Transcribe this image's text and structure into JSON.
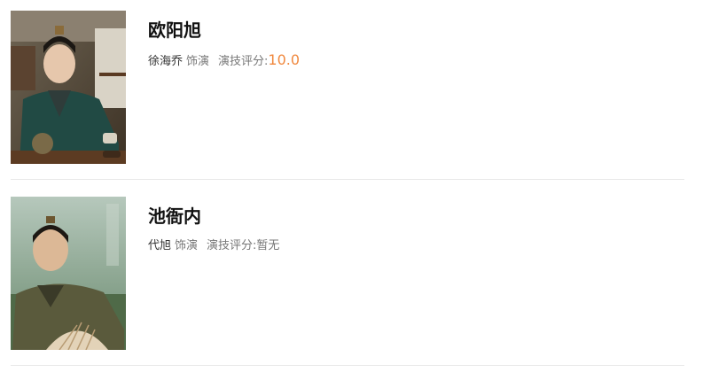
{
  "cast": [
    {
      "role": "欧阳旭",
      "actor": "徐海乔",
      "plays_label": "饰演",
      "rating_label": "演技评分:",
      "score": "10.0",
      "score_color": "#f0883e",
      "photo_icon": "character-photo"
    },
    {
      "role": "池衙内",
      "actor": "代旭",
      "plays_label": "饰演",
      "rating_label": "演技评分:",
      "score": "暂无",
      "score_color": "#777777",
      "photo_icon": "character-photo"
    }
  ]
}
